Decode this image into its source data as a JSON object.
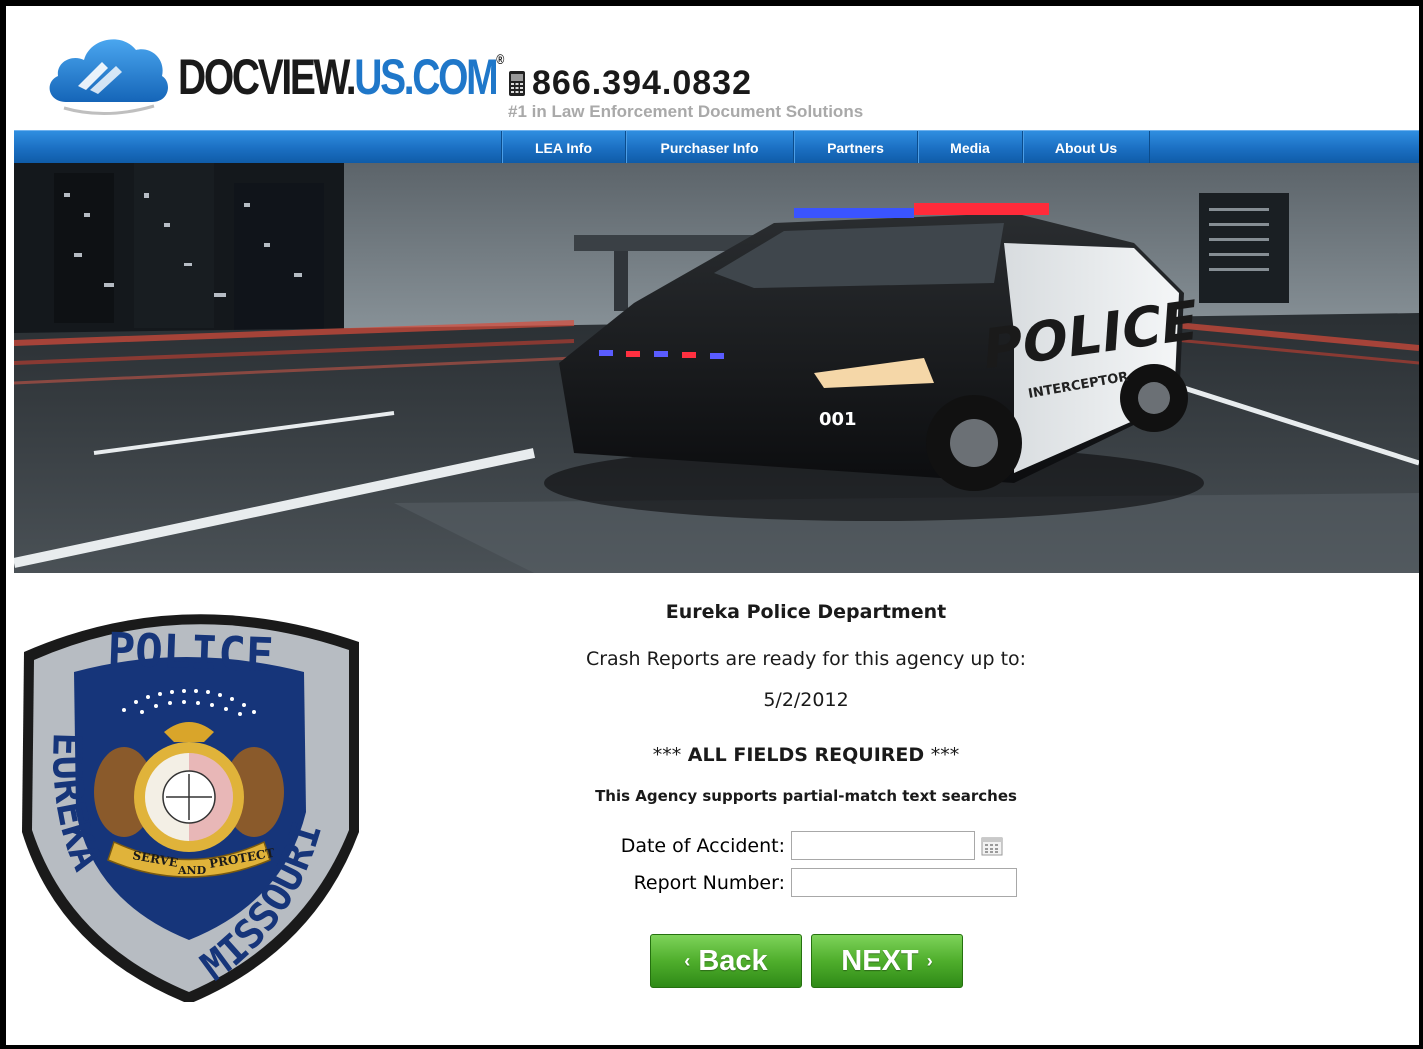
{
  "header": {
    "logo_dark_text": "DOCVIEW.",
    "logo_blue_text": "US.COM",
    "logo_tm": "®",
    "phone": "866.394.0832",
    "tagline": "#1 in Law Enforcement Document Solutions"
  },
  "nav": {
    "items": [
      {
        "label": "LEA Info"
      },
      {
        "label": "Purchaser Info"
      },
      {
        "label": "Partners"
      },
      {
        "label": "Media"
      },
      {
        "label": "About Us"
      }
    ]
  },
  "banner": {
    "car_text": "POLICE",
    "car_sub": "INTERCEPTOR",
    "car_number": "001"
  },
  "badge": {
    "top_text": "POLICE",
    "left_text": "EUREKA",
    "right_text": "MISSOURI",
    "ribbon_left": "SERVE",
    "ribbon_mid": "AND",
    "ribbon_right": "PROTECT"
  },
  "form": {
    "agency_name": "Eureka Police Department",
    "ready_text": "Crash Reports are ready for this agency up to:",
    "ready_date": "5/2/2012",
    "required_stars_left": "***",
    "required_text": " ALL FIELDS REQUIRED ",
    "required_stars_right": "***",
    "partial_text": "This Agency supports partial-match text searches",
    "date_label": "Date of Accident:",
    "date_value": "",
    "report_label": "Report Number:",
    "report_value": ""
  },
  "buttons": {
    "back_chevron": "‹",
    "back_label": "Back",
    "next_label": "NEXT",
    "next_chevron": "›"
  },
  "colors": {
    "nav_blue": "#1b6fc2",
    "brand_blue": "#1f77c9",
    "button_green": "#4fae2c"
  }
}
